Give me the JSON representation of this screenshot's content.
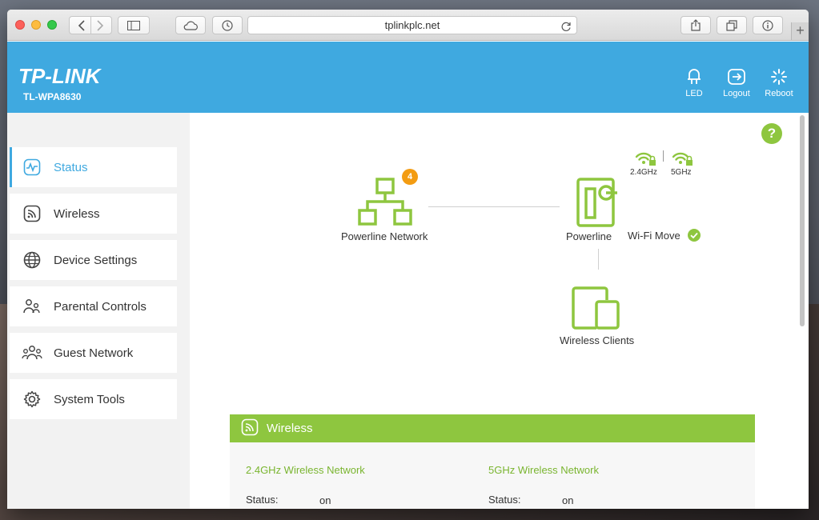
{
  "browser": {
    "url": "tplinkplc.net"
  },
  "header": {
    "brand": "TP-LINK",
    "model": "TL-WPA8630",
    "actions": [
      {
        "label": "LED",
        "icon": "led-bulb-icon"
      },
      {
        "label": "Logout",
        "icon": "logout-icon"
      },
      {
        "label": "Reboot",
        "icon": "reboot-icon"
      }
    ]
  },
  "sidebar": {
    "items": [
      {
        "label": "Status",
        "icon": "status-pulse-icon",
        "active": true
      },
      {
        "label": "Wireless",
        "icon": "wireless-icon"
      },
      {
        "label": "Device Settings",
        "icon": "globe-icon"
      },
      {
        "label": "Parental Controls",
        "icon": "parental-icon"
      },
      {
        "label": "Guest Network",
        "icon": "guest-icon"
      },
      {
        "label": "System Tools",
        "icon": "gear-icon"
      }
    ]
  },
  "diagram": {
    "powerline_network_label": "Powerline Network",
    "powerline_network_count": "4",
    "powerline_label": "Powerline",
    "wifi_move_label": "Wi-Fi Move",
    "band_24_label": "2.4GHz",
    "band_5_label": "5GHz",
    "clients_label": "Wireless Clients"
  },
  "wireless_panel": {
    "title": "Wireless",
    "net24": {
      "title": "2.4GHz Wireless Network",
      "status_label": "Status:",
      "status_value": "on"
    },
    "net5": {
      "title": "5GHz Wireless Network",
      "status_label": "Status:",
      "status_value": "on"
    }
  },
  "colors": {
    "header_blue": "#3fa9e0",
    "accent_green": "#8ec63f",
    "badge_orange": "#f39c12"
  }
}
